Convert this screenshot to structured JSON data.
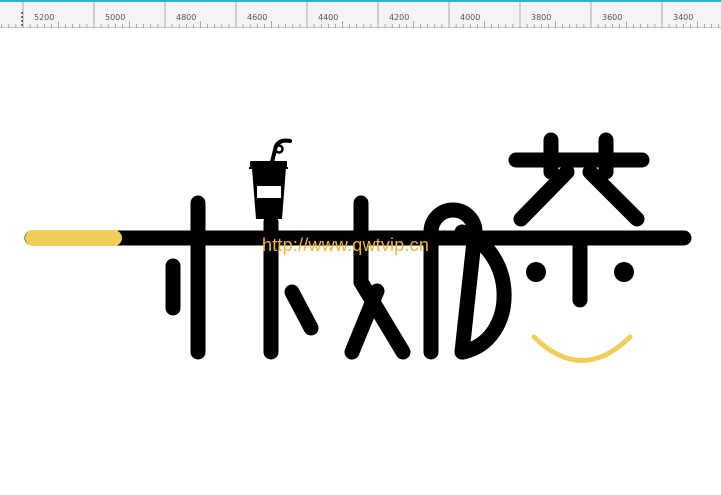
{
  "ruler": {
    "labels": [
      "5200",
      "5000",
      "4800",
      "4600",
      "4400",
      "4200",
      "4000",
      "3800",
      "3600",
      "3400"
    ]
  },
  "watermark": {
    "text": "http://www.qwtvip.cn"
  },
  "colors": {
    "accent_cyan": "#2bb3d6",
    "logo_black": "#000000",
    "logo_yellow": "#f1cd5a",
    "watermark": "#f0b43a"
  },
  "icons": {
    "cup": "takeaway-cup-with-straw",
    "smile": "smile-arc"
  }
}
